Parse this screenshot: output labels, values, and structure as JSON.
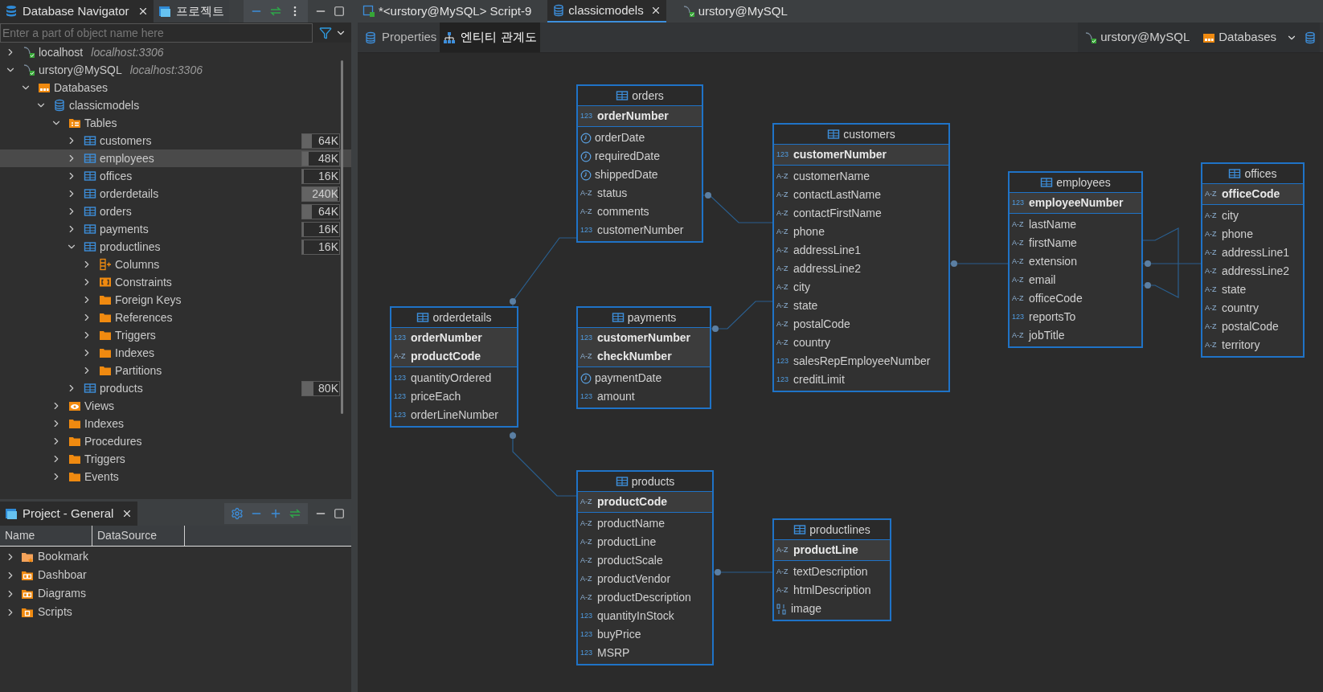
{
  "navigator": {
    "tabs": [
      {
        "label": "Database Navigator",
        "kind": "navigator",
        "selected": true,
        "closable": true
      },
      {
        "label": "프로젝트",
        "kind": "project",
        "selected": false,
        "closable": false
      }
    ],
    "search": {
      "placeholder": "Enter a part of object name here"
    },
    "tree": [
      {
        "label": "localhost",
        "detail": "localhost:3306",
        "kind": "connection",
        "expanded": false,
        "selected": false
      },
      {
        "label": "urstory@MySQL",
        "detail": "localhost:3306",
        "kind": "connection",
        "expanded": true,
        "selected": false,
        "children": [
          {
            "label": "Databases",
            "kind": "databases",
            "expanded": true,
            "selected": false,
            "children": [
              {
                "label": "classicmodels",
                "kind": "database",
                "expanded": true,
                "selected": false,
                "children": [
                  {
                    "label": "Tables",
                    "kind": "tables",
                    "expanded": true,
                    "selected": false,
                    "children": [
                      {
                        "label": "customers",
                        "kind": "table",
                        "expanded": false,
                        "selected": false,
                        "size": "64K",
                        "level": 0.25
                      },
                      {
                        "label": "employees",
                        "kind": "table",
                        "expanded": false,
                        "selected": true,
                        "size": "48K",
                        "level": 0.18
                      },
                      {
                        "label": "offices",
                        "kind": "table",
                        "expanded": false,
                        "selected": false,
                        "size": "16K",
                        "level": 0.05
                      },
                      {
                        "label": "orderdetails",
                        "kind": "table",
                        "expanded": false,
                        "selected": false,
                        "size": "240K",
                        "level": 0.95
                      },
                      {
                        "label": "orders",
                        "kind": "table",
                        "expanded": false,
                        "selected": false,
                        "size": "64K",
                        "level": 0.25
                      },
                      {
                        "label": "payments",
                        "kind": "table",
                        "expanded": false,
                        "selected": false,
                        "size": "16K",
                        "level": 0.05
                      },
                      {
                        "label": "productlines",
                        "kind": "table",
                        "expanded": true,
                        "selected": false,
                        "size": "16K",
                        "level": 0.05,
                        "children": [
                          {
                            "label": "Columns",
                            "kind": "columns",
                            "expanded": false,
                            "selected": false
                          },
                          {
                            "label": "Constraints",
                            "kind": "constraints",
                            "expanded": false,
                            "selected": false
                          },
                          {
                            "label": "Foreign Keys",
                            "kind": "folder",
                            "expanded": false,
                            "selected": false
                          },
                          {
                            "label": "References",
                            "kind": "folder",
                            "expanded": false,
                            "selected": false
                          },
                          {
                            "label": "Triggers",
                            "kind": "folder",
                            "expanded": false,
                            "selected": false
                          },
                          {
                            "label": "Indexes",
                            "kind": "folder",
                            "expanded": false,
                            "selected": false
                          },
                          {
                            "label": "Partitions",
                            "kind": "folder",
                            "expanded": false,
                            "selected": false
                          }
                        ]
                      },
                      {
                        "label": "products",
                        "kind": "table",
                        "expanded": false,
                        "selected": false,
                        "size": "80K",
                        "level": 0.3
                      }
                    ]
                  },
                  {
                    "label": "Views",
                    "kind": "views",
                    "expanded": false,
                    "selected": false
                  },
                  {
                    "label": "Indexes",
                    "kind": "folder",
                    "expanded": false,
                    "selected": false
                  },
                  {
                    "label": "Procedures",
                    "kind": "folder",
                    "expanded": false,
                    "selected": false
                  },
                  {
                    "label": "Triggers",
                    "kind": "folder",
                    "expanded": false,
                    "selected": false
                  },
                  {
                    "label": "Events",
                    "kind": "folder",
                    "expanded": false,
                    "selected": false
                  }
                ]
              }
            ]
          }
        ]
      }
    ]
  },
  "project": {
    "tab": "Project - General",
    "columns": [
      "Name",
      "DataSource"
    ],
    "rows": [
      {
        "label": "Bookmark",
        "kind": "bookmarks"
      },
      {
        "label": "Dashboar",
        "kind": "dashboards"
      },
      {
        "label": "Diagrams",
        "kind": "dashboards"
      },
      {
        "label": "Scripts",
        "kind": "scripts"
      }
    ]
  },
  "editor_tabs": [
    {
      "label": "*<urstory@MySQL> Script-9",
      "kind": "script",
      "selected": false,
      "closable": false
    },
    {
      "label": "classicmodels",
      "kind": "database",
      "selected": true,
      "closable": true
    },
    {
      "label": "urstory@MySQL",
      "kind": "connection",
      "selected": false,
      "closable": false
    }
  ],
  "sub_tabs": [
    {
      "label": "Properties",
      "kind": "properties",
      "selected": false
    },
    {
      "label": "엔티티 관계도",
      "kind": "diagram",
      "selected": true
    }
  ],
  "breadcrumb": [
    {
      "label": "urstory@MySQL",
      "kind": "connection"
    },
    {
      "label": "Databases",
      "kind": "databases"
    }
  ],
  "entities": [
    {
      "name": "orders",
      "key_columns": [
        {
          "name": "orderNumber",
          "kind": "number",
          "badge": "123"
        }
      ],
      "columns": [
        {
          "name": "orderDate",
          "kind": "date"
        },
        {
          "name": "requiredDate",
          "kind": "date"
        },
        {
          "name": "shippedDate",
          "kind": "date"
        },
        {
          "name": "status",
          "kind": "text",
          "badge": "A-Z"
        },
        {
          "name": "comments",
          "kind": "text",
          "badge": "A-Z"
        },
        {
          "name": "customerNumber",
          "kind": "number",
          "badge": "123"
        }
      ]
    },
    {
      "name": "customers",
      "key_columns": [
        {
          "name": "customerNumber",
          "kind": "number",
          "badge": "123"
        }
      ],
      "columns": [
        {
          "name": "customerName",
          "kind": "text",
          "badge": "A-Z"
        },
        {
          "name": "contactLastName",
          "kind": "text",
          "badge": "A-Z"
        },
        {
          "name": "contactFirstName",
          "kind": "text",
          "badge": "A-Z"
        },
        {
          "name": "phone",
          "kind": "text",
          "badge": "A-Z"
        },
        {
          "name": "addressLine1",
          "kind": "text",
          "badge": "A-Z"
        },
        {
          "name": "addressLine2",
          "kind": "text",
          "badge": "A-Z"
        },
        {
          "name": "city",
          "kind": "text",
          "badge": "A-Z"
        },
        {
          "name": "state",
          "kind": "text",
          "badge": "A-Z"
        },
        {
          "name": "postalCode",
          "kind": "text",
          "badge": "A-Z"
        },
        {
          "name": "country",
          "kind": "text",
          "badge": "A-Z"
        },
        {
          "name": "salesRepEmployeeNumber",
          "kind": "number",
          "badge": "123"
        },
        {
          "name": "creditLimit",
          "kind": "number",
          "badge": "123"
        }
      ]
    },
    {
      "name": "employees",
      "key_columns": [
        {
          "name": "employeeNumber",
          "kind": "number",
          "badge": "123"
        }
      ],
      "columns": [
        {
          "name": "lastName",
          "kind": "text",
          "badge": "A-Z"
        },
        {
          "name": "firstName",
          "kind": "text",
          "badge": "A-Z"
        },
        {
          "name": "extension",
          "kind": "text",
          "badge": "A-Z"
        },
        {
          "name": "email",
          "kind": "text",
          "badge": "A-Z"
        },
        {
          "name": "officeCode",
          "kind": "text",
          "badge": "A-Z"
        },
        {
          "name": "reportsTo",
          "kind": "number",
          "badge": "123"
        },
        {
          "name": "jobTitle",
          "kind": "text",
          "badge": "A-Z"
        }
      ]
    },
    {
      "name": "offices",
      "key_columns": [
        {
          "name": "officeCode",
          "kind": "text",
          "badge": "A-Z"
        }
      ],
      "columns": [
        {
          "name": "city",
          "kind": "text",
          "badge": "A-Z"
        },
        {
          "name": "phone",
          "kind": "text",
          "badge": "A-Z"
        },
        {
          "name": "addressLine1",
          "kind": "text",
          "badge": "A-Z"
        },
        {
          "name": "addressLine2",
          "kind": "text",
          "badge": "A-Z"
        },
        {
          "name": "state",
          "kind": "text",
          "badge": "A-Z"
        },
        {
          "name": "country",
          "kind": "text",
          "badge": "A-Z"
        },
        {
          "name": "postalCode",
          "kind": "text",
          "badge": "A-Z"
        },
        {
          "name": "territory",
          "kind": "text",
          "badge": "A-Z"
        }
      ]
    },
    {
      "name": "orderdetails",
      "key_columns": [
        {
          "name": "orderNumber",
          "kind": "number",
          "badge": "123"
        },
        {
          "name": "productCode",
          "kind": "text",
          "badge": "A-Z"
        }
      ],
      "columns": [
        {
          "name": "quantityOrdered",
          "kind": "number",
          "badge": "123"
        },
        {
          "name": "priceEach",
          "kind": "number",
          "badge": "123"
        },
        {
          "name": "orderLineNumber",
          "kind": "number",
          "badge": "123"
        }
      ]
    },
    {
      "name": "payments",
      "key_columns": [
        {
          "name": "customerNumber",
          "kind": "number",
          "badge": "123"
        },
        {
          "name": "checkNumber",
          "kind": "text",
          "badge": "A-Z"
        }
      ],
      "columns": [
        {
          "name": "paymentDate",
          "kind": "date"
        },
        {
          "name": "amount",
          "kind": "number",
          "badge": "123"
        }
      ]
    },
    {
      "name": "products",
      "key_columns": [
        {
          "name": "productCode",
          "kind": "text",
          "badge": "A-Z"
        }
      ],
      "columns": [
        {
          "name": "productName",
          "kind": "text",
          "badge": "A-Z"
        },
        {
          "name": "productLine",
          "kind": "text",
          "badge": "A-Z"
        },
        {
          "name": "productScale",
          "kind": "text",
          "badge": "A-Z"
        },
        {
          "name": "productVendor",
          "kind": "text",
          "badge": "A-Z"
        },
        {
          "name": "productDescription",
          "kind": "text",
          "badge": "A-Z"
        },
        {
          "name": "quantityInStock",
          "kind": "number",
          "badge": "123"
        },
        {
          "name": "buyPrice",
          "kind": "number",
          "badge": "123"
        },
        {
          "name": "MSRP",
          "kind": "number",
          "badge": "123"
        }
      ]
    },
    {
      "name": "productlines",
      "key_columns": [
        {
          "name": "productLine",
          "kind": "text",
          "badge": "A-Z"
        }
      ],
      "columns": [
        {
          "name": "textDescription",
          "kind": "text",
          "badge": "A-Z"
        },
        {
          "name": "htmlDescription",
          "kind": "text",
          "badge": "A-Z"
        },
        {
          "name": "image",
          "kind": "binary"
        }
      ]
    }
  ]
}
